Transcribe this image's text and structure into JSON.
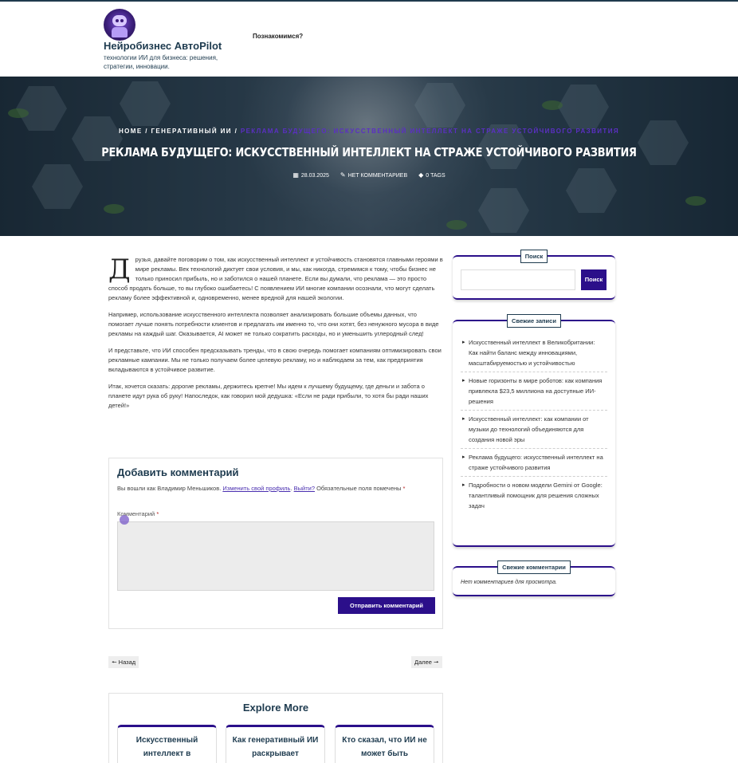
{
  "header": {
    "site_title": "Нейробизнес АвтоPilot",
    "site_description": "технологии ИИ для бизнеса: решения, стратегии, инновации.",
    "nav_items": [
      "Познакомимся?"
    ]
  },
  "hero": {
    "breadcrumb": {
      "home": "HOME",
      "separator": "/",
      "category": "ГЕНЕРАТИВНЫЙ ИИ",
      "current": "РЕКЛАМА БУДУЩЕГО: ИСКУССТВЕННЫЙ ИНТЕЛЛЕКТ НА СТРАЖЕ УСТОЙЧИВОГО РАЗВИТИЯ"
    },
    "title": "РЕКЛАМА БУДУЩЕГО: ИСКУССТВЕННЫЙ ИНТЕЛЛЕКТ НА СТРАЖЕ УСТОЙЧИВОГО РАЗВИТИЯ",
    "meta": {
      "date": "28.03.2025",
      "comments": "НЕТ КОММЕНТАРИЕВ",
      "tags": "0 TAGS",
      "date_icon": "calendar-icon",
      "comments_icon": "comments-icon",
      "tags_icon": "tag-icon"
    }
  },
  "article": {
    "dropcap": "Д",
    "paragraphs": [
      "рузья, давайте поговорим о том, как искусственный интеллект и устойчивость становятся главными героями в мире рекламы. Век технологий диктует свои условия, и мы, как никогда, стремимся к тому, чтобы бизнес не только приносил прибыль, но и заботился о нашей планете. Если вы думали, что реклама — это просто способ продать больше, то вы глубоко ошибаетесь! С появлением ИИ многие компании осознали, что могут сделать рекламу более эффективной и, одновременно, менее вредной для нашей экологии.",
      "Например, использование искусственного интеллекта позволяет анализировать большие объемы данных, что помогает лучше понять потребности клиентов и предлагать им именно то, что они хотят, без ненужного мусора в виде рекламы на каждый шаг. Оказывается, AI может не только сократить расходы, но и уменьшить углеродный след!",
      "И представьте, что ИИ способен предсказывать тренды, что в свою очередь помогает компаниям оптимизировать свои рекламные кампании. Мы не только получаем более целевую рекламу, но и наблюдаем за тем, как предприятия вкладываются в устойчивое развитие.",
      "Итак, хочется сказать: дорогие рекламы, держитесь крепче! Мы идем к лучшему будущему, где деньги и забота о планете идут рука об руку! Напоследок, как говорил мой дедушка: «Если не ради прибыли, то хотя бы ради наших детей!»"
    ]
  },
  "comment_form": {
    "title": "Добавить комментарий",
    "logged_in_prefix": "Вы вошли как Владимир Меньшиков.",
    "edit_profile": "Изменить свой профиль",
    "logout": "Выйти?",
    "required_note": "Обязательные поля помечены",
    "required_mark": "*",
    "comment_label": "Комментарий",
    "submit": "Отправить комментарий"
  },
  "post_nav": {
    "prev": "Назад",
    "next": "Далее",
    "prev_icon": "arrow-left-icon",
    "next_icon": "arrow-right-icon"
  },
  "explore": {
    "title": "Explore More",
    "cards": [
      "Искусственный интеллект в",
      "Как генеративный ИИ раскрывает потенциал",
      "Кто сказал, что ИИ не может быть веселым?"
    ]
  },
  "sidebar": {
    "search": {
      "title": "Поиск",
      "placeholder": "",
      "button": "Поиск"
    },
    "recent_posts": {
      "title": "Свежие записи",
      "items": [
        "Искусственный интеллект в Великобритании: Как найти баланс между инновациями, масштабируемостью и устойчивостью",
        "Новые горизонты в мире роботов: как компания привлекла $23,5 миллиона на доступные ИИ-решения",
        "Искусственный интеллект: как компании от музыки до технологий объединяются для создания новой эры",
        "Реклама будущего: искусственный интеллект на страже устойчивого развития",
        "Подробности о новом модели Gemini от Google: талантливый помощник для решения сложных задач"
      ]
    },
    "recent_comments": {
      "title": "Свежие комментарии",
      "empty": "Нет комментариев для просмотра."
    }
  },
  "colors": {
    "accent": "#2b0f8a",
    "heading": "#1e3b4f"
  }
}
